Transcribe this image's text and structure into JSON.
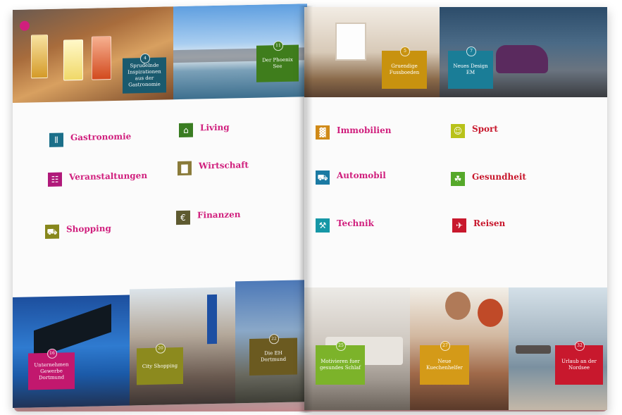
{
  "left_page": {
    "top_tags": [
      {
        "text": "Sprudelnde Inspirationen aus der Gastronomie",
        "num": "4",
        "color": "#1a5a6e"
      },
      {
        "text": "Der Phoenix See",
        "num": "11",
        "color": "#3f7d1c"
      }
    ],
    "categories": [
      {
        "title": "Gastronomie",
        "icon": "cutlery-icon",
        "icon_glyph": "⫴",
        "icon_color": "#1b6f89",
        "lines": 2
      },
      {
        "title": "Veranstaltungen",
        "icon": "calendar-icon",
        "icon_glyph": "☷",
        "icon_color": "#b0197a",
        "lines": 4
      },
      {
        "title": "Shopping",
        "icon": "cart-icon",
        "icon_glyph": "⛟",
        "icon_color": "#87871c",
        "lines": 2
      },
      {
        "title": "Living",
        "icon": "home-icon",
        "icon_glyph": "⌂",
        "icon_color": "#3a7d22",
        "lines": 1
      },
      {
        "title": "Wirtschaft",
        "icon": "chart-icon",
        "icon_glyph": "▇",
        "icon_color": "#8a7b3a",
        "lines": 3
      },
      {
        "title": "Finanzen",
        "icon": "euro-icon",
        "icon_glyph": "€",
        "icon_color": "#5e5a30",
        "lines": 3
      }
    ],
    "bottom_tags": [
      {
        "text": "Unternehmen Gewerbe Dortmund",
        "num": "16",
        "color": "#c2186e"
      },
      {
        "text": "City Shopping",
        "num": "20",
        "color": "#8c8a1e"
      },
      {
        "text": "Die EH Dortmund",
        "num": "22",
        "color": "#6b5a20"
      }
    ]
  },
  "right_page": {
    "top_tags": [
      {
        "text": "Gruendige Fussboeden",
        "num": "5",
        "color": "#c8920f"
      },
      {
        "text": "Neues Design EM",
        "num": "7",
        "color": "#1a7d97"
      }
    ],
    "categories": [
      {
        "title": "Immobilien",
        "icon": "building-icon",
        "icon_glyph": "▓",
        "icon_color": "#d08a18",
        "lines": 3
      },
      {
        "title": "Automobil",
        "icon": "car-icon",
        "icon_glyph": "⛟",
        "icon_color": "#1b7aa3",
        "lines": 3
      },
      {
        "title": "Technik",
        "icon": "wrench-icon",
        "icon_glyph": "⚒",
        "icon_color": "#1697a6",
        "lines": 3
      },
      {
        "title": "Sport",
        "icon": "runner-icon",
        "icon_glyph": "☺",
        "icon_color": "#b8c21a",
        "lines": 3
      },
      {
        "title": "Gesundheit",
        "icon": "leaf-icon",
        "icon_glyph": "☘",
        "icon_color": "#55a82a",
        "lines": 3
      },
      {
        "title": "Reisen",
        "icon": "plane-icon",
        "icon_glyph": "✈",
        "icon_color": "#c8182d",
        "lines": 3
      }
    ],
    "bottom_tags": [
      {
        "text": "Motivieren fuer gesundes Schlaf",
        "num": "25",
        "color": "#7cb32a"
      },
      {
        "text": "Neue Kuechenhelfer",
        "num": "27",
        "color": "#d49a18"
      },
      {
        "text": "Urlaub an der Nordsee",
        "num": "32",
        "color": "#c8182d"
      }
    ]
  },
  "colors": {
    "title_pink": "#d01f7d",
    "title_red": "#c8182d"
  }
}
